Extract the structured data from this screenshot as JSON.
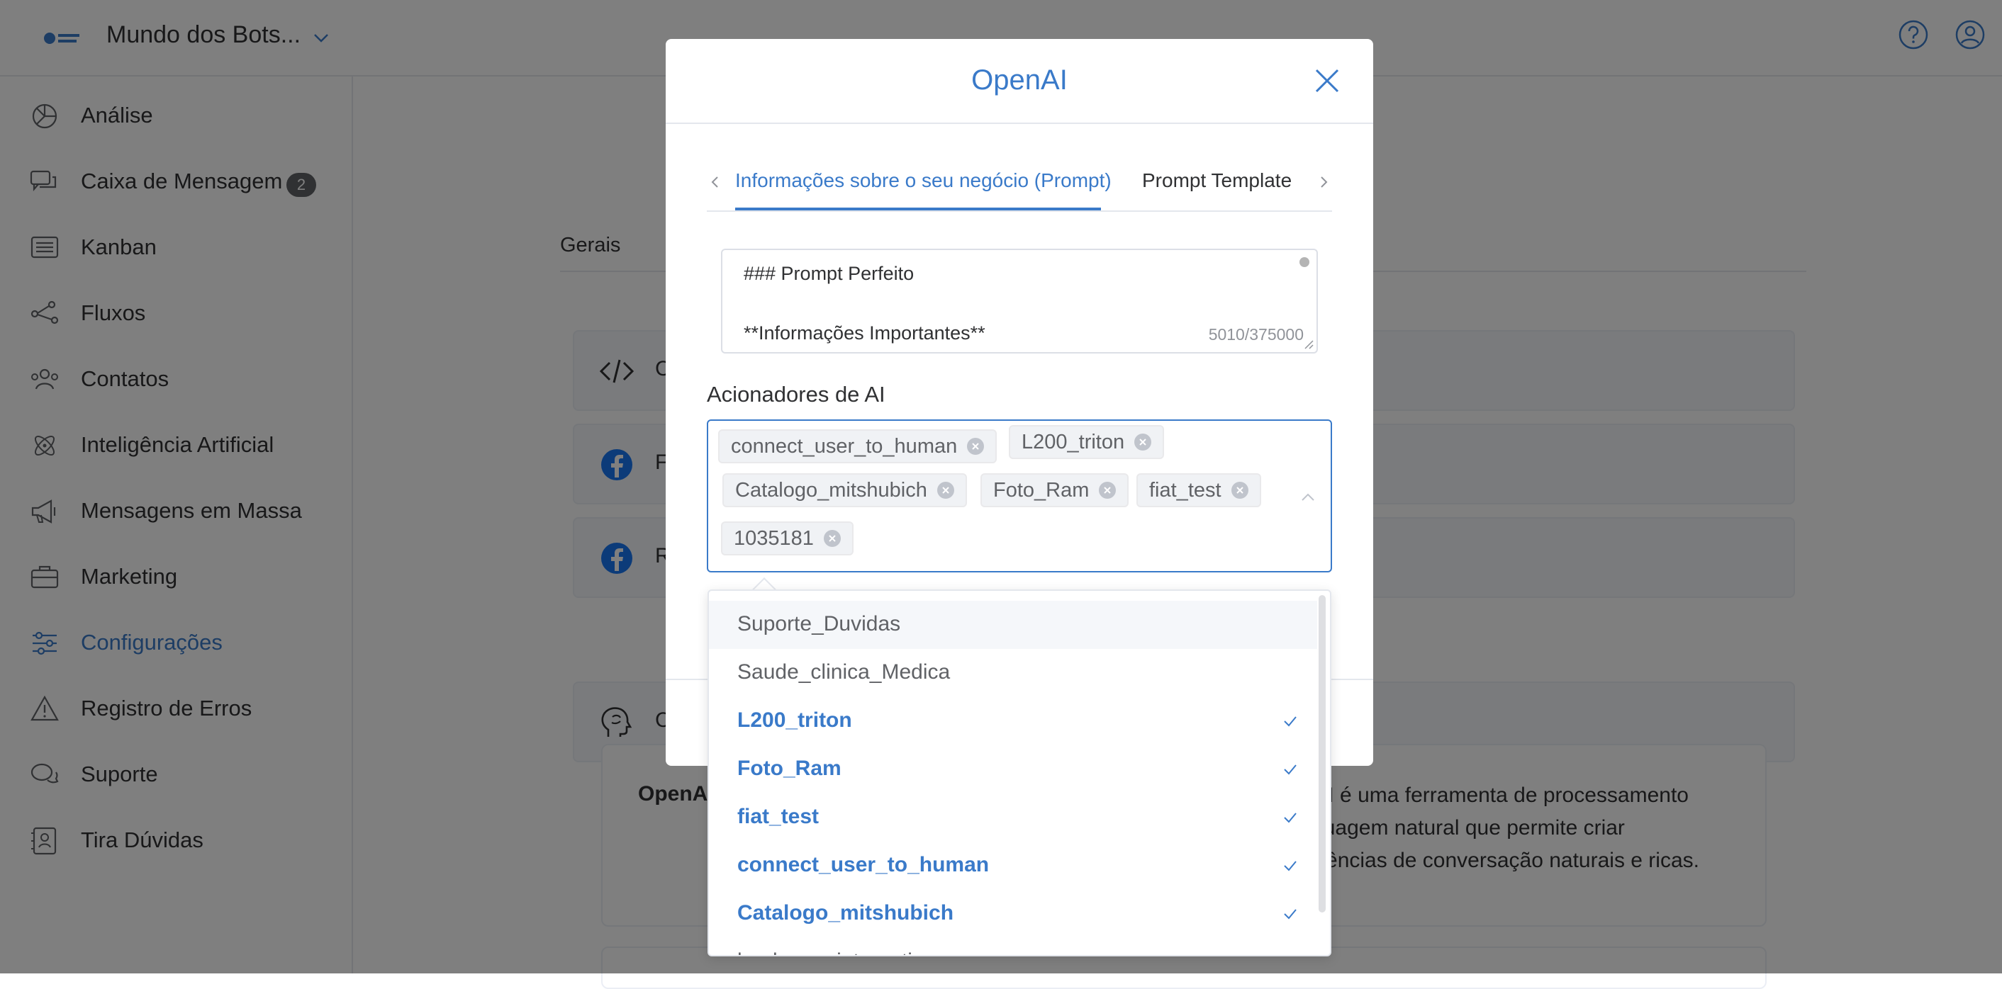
{
  "topbar": {
    "workspace_name": "Mundo dos Bots..."
  },
  "sidebar": {
    "items": [
      {
        "label": "Análise",
        "icon": "pie-chart-icon"
      },
      {
        "label": "Caixa de Mensagem",
        "icon": "chat-bubbles-icon",
        "badge": "2"
      },
      {
        "label": "Kanban",
        "icon": "list-board-icon"
      },
      {
        "label": "Fluxos",
        "icon": "flow-nodes-icon"
      },
      {
        "label": "Contatos",
        "icon": "people-icon"
      },
      {
        "label": "Inteligência Artificial",
        "icon": "atom-icon"
      },
      {
        "label": "Mensagens em Massa",
        "icon": "megaphone-icon"
      },
      {
        "label": "Marketing",
        "icon": "briefcase-icon"
      },
      {
        "label": "Configurações",
        "icon": "sliders-icon",
        "active": true
      },
      {
        "label": "Registro de Erros",
        "icon": "warning-icon"
      },
      {
        "label": "Suporte",
        "icon": "support-chat-icon"
      },
      {
        "label": "Tira Dúvidas",
        "icon": "contact-book-icon"
      }
    ]
  },
  "background": {
    "tab_label": "Gerais",
    "rows": [
      {
        "text": "C",
        "icon": "code-icon"
      },
      {
        "text": "F",
        "icon": "facebook-icon"
      },
      {
        "text": "R",
        "icon": "facebook-icon"
      },
      {
        "text": "C",
        "icon": "brain-head-icon"
      }
    ],
    "description_title": "OpenAI",
    "description_lines": [
      "enAI é uma ferramenta de processamento",
      "linguagem natural que permite criar",
      "periências de conversação naturais e ricas."
    ]
  },
  "dialog": {
    "title": "OpenAI",
    "tabs": [
      {
        "label": "Informações sobre o seu negócio (Prompt)",
        "active": true
      },
      {
        "label": "Prompt Template",
        "active": false
      }
    ],
    "prompt": {
      "line1": "### Prompt Perfeito",
      "line2": "**Informações Importantes**",
      "counter": "5010/375000"
    },
    "triggers_label": "Acionadores de AI",
    "selected_tags": [
      "connect_user_to_human",
      "L200_triton",
      "Catalogo_mitshubich",
      "Foto_Ram",
      "fiat_test",
      "1035181"
    ]
  },
  "dropdown": {
    "options": [
      {
        "label": "Suporte_Duvidas",
        "selected": false,
        "hover": true
      },
      {
        "label": "Saude_clinica_Medica",
        "selected": false
      },
      {
        "label": "L200_triton",
        "selected": true
      },
      {
        "label": "Foto_Ram",
        "selected": true
      },
      {
        "label": "fiat_test",
        "selected": true
      },
      {
        "label": "connect_user_to_human",
        "selected": true
      },
      {
        "label": "Catalogo_mitshubich",
        "selected": true
      },
      {
        "label": "landpage_integration",
        "selected": false
      }
    ]
  },
  "colors": {
    "accent": "#3a7ac9",
    "text": "#303133",
    "muted": "#606266"
  }
}
